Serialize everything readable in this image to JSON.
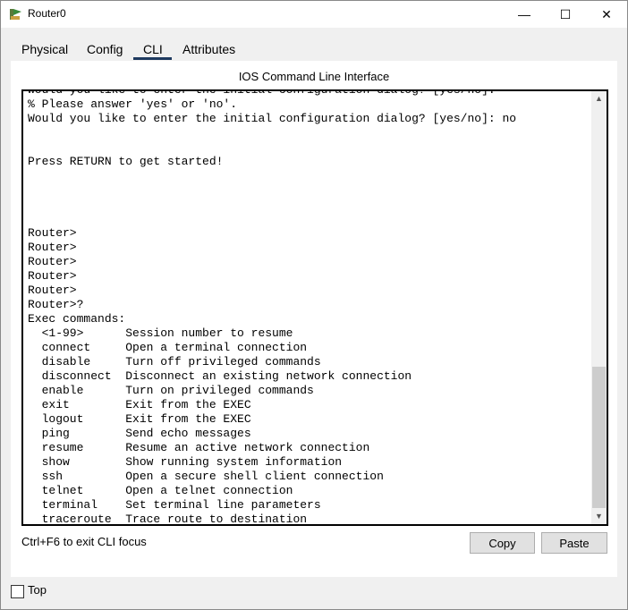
{
  "window": {
    "title": "Router0",
    "minimize": "—",
    "maximize": "☐",
    "close": "✕"
  },
  "tabs": [
    {
      "label": "Physical"
    },
    {
      "label": "Config"
    },
    {
      "label": "CLI",
      "active": true
    },
    {
      "label": "Attributes"
    }
  ],
  "cli": {
    "heading": "IOS Command Line Interface",
    "lines": [
      "Would you like to enter the initial configuration dialog? [yes/no]:",
      "% Please answer 'yes' or 'no'.",
      "Would you like to enter the initial configuration dialog? [yes/no]: no",
      "",
      "",
      "Press RETURN to get started!",
      "",
      "",
      "",
      "",
      "Router>",
      "Router>",
      "Router>",
      "Router>",
      "Router>",
      "Router>?",
      "Exec commands:",
      "  <1-99>      Session number to resume",
      "  connect     Open a terminal connection",
      "  disable     Turn off privileged commands",
      "  disconnect  Disconnect an existing network connection",
      "  enable      Turn on privileged commands",
      "  exit        Exit from the EXEC",
      "  logout      Exit from the EXEC",
      "  ping        Send echo messages",
      "  resume      Resume an active network connection",
      "  show        Show running system information",
      "  ssh         Open a secure shell client connection",
      "  telnet      Open a telnet connection",
      "  terminal    Set terminal line parameters",
      "  traceroute  Trace route to destination"
    ],
    "prompt": "Router>"
  },
  "footer": {
    "focus_hint": "Ctrl+F6 to exit CLI focus",
    "copy_label": "Copy",
    "paste_label": "Paste"
  },
  "top_checkbox": {
    "label": "Top",
    "checked": false
  }
}
